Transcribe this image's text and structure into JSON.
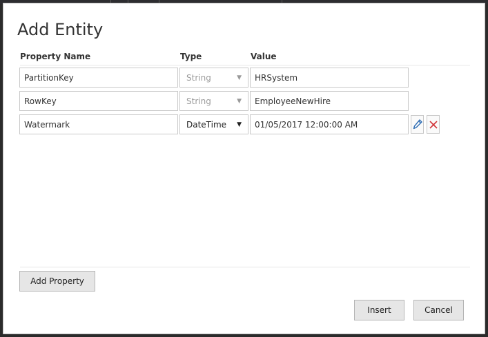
{
  "dialog": {
    "title": "Add Entity",
    "columns": {
      "property_name": "Property Name",
      "type": "Type",
      "value": "Value"
    },
    "rows": [
      {
        "name": "PartitionKey",
        "type": "String",
        "value": "HRSystem",
        "editable_type": false
      },
      {
        "name": "RowKey",
        "type": "String",
        "value": "EmployeeNewHire",
        "editable_type": false
      },
      {
        "name": "Watermark",
        "type": "DateTime",
        "value": "01/05/2017  12:00:00  AM",
        "editable_type": true
      }
    ],
    "add_property_label": "Add Property",
    "insert_label": "Insert",
    "cancel_label": "Cancel"
  },
  "icons": {
    "edit": "pencil-icon",
    "delete": "close-icon",
    "dropdown": "chevron-down-icon"
  },
  "colors": {
    "edit_icon": "#2e6db4",
    "delete_icon": "#d13438",
    "button_bg": "#e6e6e6"
  }
}
